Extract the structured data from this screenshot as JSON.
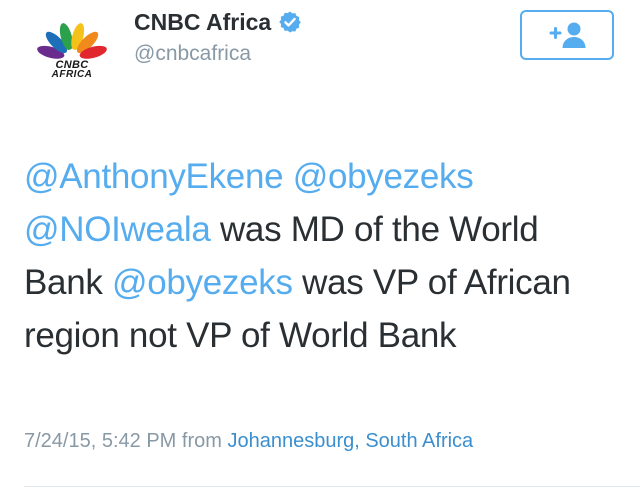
{
  "author": {
    "display_name": "CNBC Africa",
    "handle": "@cnbcafrica",
    "verified": true,
    "avatar": {
      "line1": "CNBC",
      "line2": "AFRICA"
    }
  },
  "follow_button": {
    "icon": "follow-user-plus-icon"
  },
  "tweet": {
    "segments": [
      {
        "text": "@AnthonyEkene",
        "kind": "mention"
      },
      {
        "text": " ",
        "kind": "text"
      },
      {
        "text": "@obyezeks",
        "kind": "mention"
      },
      {
        "text": " ",
        "kind": "text"
      },
      {
        "text": "@NOIweala",
        "kind": "mention"
      },
      {
        "text": " was MD of the World Bank ",
        "kind": "text"
      },
      {
        "text": "@obyezeks",
        "kind": "mention"
      },
      {
        "text": " was VP of African region not VP of World Bank",
        "kind": "text"
      }
    ]
  },
  "meta": {
    "timestamp": "7/24/15, 5:42 PM",
    "from_label": "from",
    "location": "Johannesburg, South Africa"
  },
  "colors": {
    "link": "#55acee",
    "text": "#292f33",
    "muted": "#8899a6",
    "verified": "#55acee"
  }
}
